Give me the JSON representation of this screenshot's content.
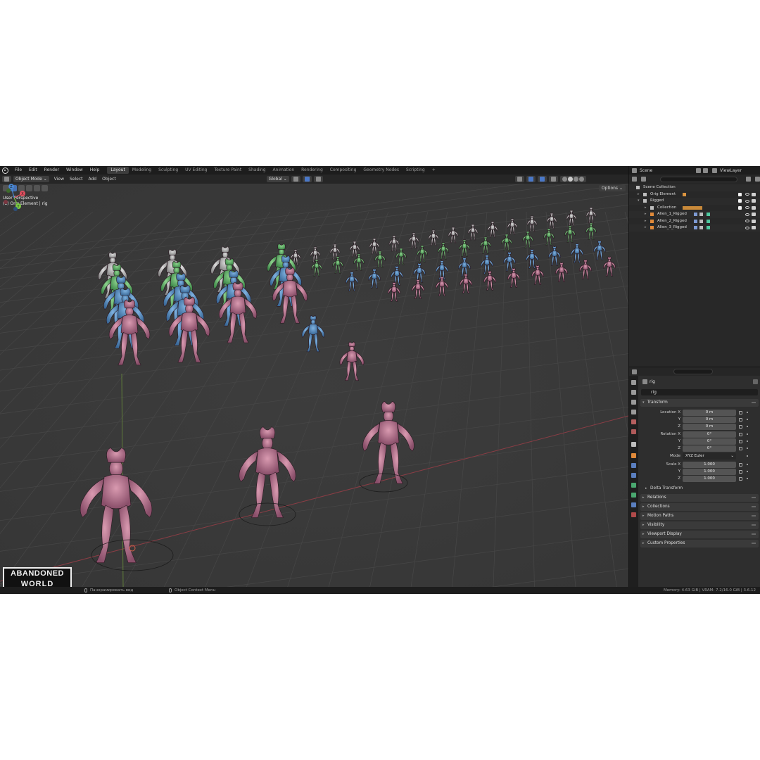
{
  "topbar": {
    "menus": [
      "File",
      "Edit",
      "Render",
      "Window",
      "Help"
    ],
    "workspaces": [
      "Layout",
      "Modeling",
      "Sculpting",
      "UV Editing",
      "Texture Paint",
      "Shading",
      "Animation",
      "Rendering",
      "Compositing",
      "Geometry Nodes",
      "Scripting"
    ],
    "active_workspace": "Layout",
    "add_tab": "+"
  },
  "viewport_header": {
    "mode": "Object Mode",
    "menus": [
      "View",
      "Select",
      "Add",
      "Object"
    ],
    "orientation": "Global",
    "options": "Options"
  },
  "viewport": {
    "perspective": "User Perspective",
    "active_info": "(1) Orig Element | rig",
    "axis_colors": {
      "x": "#e04f5f",
      "y": "#7ac943",
      "z": "#4a8bd8"
    },
    "axes": [
      "X",
      "Y",
      "Z"
    ]
  },
  "logo": {
    "line1": "ABANDONED",
    "line2": "WORLD"
  },
  "scene": {
    "name": "Scene",
    "view_layer": "ViewLayer"
  },
  "outliner": {
    "rows": [
      {
        "label": "Scene Collection",
        "indent": 0
      },
      {
        "label": "Orig Element",
        "indent": 1
      },
      {
        "label": "Rigged",
        "indent": 1
      },
      {
        "label": "Collection",
        "indent": 2
      },
      {
        "label": "Alien_1_Rigged",
        "indent": 2
      },
      {
        "label": "Alien_2_Rigged",
        "indent": 2
      },
      {
        "label": "Alien_3_Rigged",
        "indent": 2
      }
    ]
  },
  "properties": {
    "object_name": "rig",
    "object_field": "rig",
    "transform": {
      "title": "Transform",
      "location_label": "Location X",
      "location": [
        "0 m",
        "0 m",
        "0 m"
      ],
      "rotation_label": "Rotation X",
      "rotation": [
        "0°",
        "0°",
        "0°"
      ],
      "mode_label": "Mode",
      "mode": "XYZ Euler",
      "scale_label": "Scale X",
      "scale": [
        "1.000",
        "1.000",
        "1.000"
      ],
      "y_label": "Y",
      "z_label": "Z",
      "delta": "Delta Transform"
    },
    "panels": [
      "Relations",
      "Collections",
      "Motion Paths",
      "Visibility",
      "Viewport Display",
      "Custom Properties"
    ]
  },
  "statusbar": {
    "left_hint": "Панорамировать вид",
    "mid_hint": "Object Context Menu",
    "right_info": "Memory: 4.63 GiB | VRAM: 7.2/16.0 GiB | 3.6.12"
  }
}
